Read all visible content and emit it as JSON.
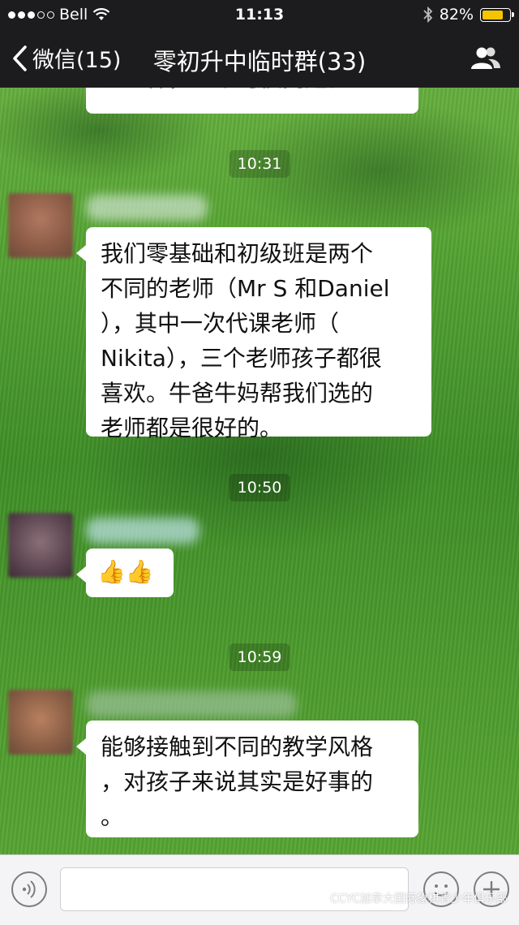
{
  "status_bar": {
    "carrier": "Bell",
    "time": "11:13",
    "battery": "82%",
    "battery_level": 0.82
  },
  "nav": {
    "back_label": "微信(15)",
    "title": "零初升中临时群(33)"
  },
  "messages": [
    {
      "kind": "partial",
      "lines": [
        "上一样，一个习惯问题。"
      ]
    },
    {
      "kind": "time",
      "text": "10:31"
    },
    {
      "kind": "text",
      "lines": [
        "我们零基础和初级班是两个",
        "不同的老师（Mr S 和Daniel",
        "），其中一次代课老师（",
        "Nikita），三个老师孩子都很",
        "喜欢。牛爸牛妈帮我们选的",
        "老师都是很好的。"
      ]
    },
    {
      "kind": "time",
      "text": "10:50"
    },
    {
      "kind": "emoji",
      "text": "👍👍"
    },
    {
      "kind": "time",
      "text": "10:59"
    },
    {
      "kind": "text",
      "lines": [
        "能够接触到不同的教学风格",
        "，对孩子来说其实是好事的",
        "。"
      ]
    }
  ],
  "watermark": "CCYC加拿大国际象棋青少年俱乐部",
  "colors": {
    "bar_dark": "#1c1c1e",
    "bubble": "#ffffff",
    "battery": "#f5c400",
    "grass": "#4f9e2e"
  }
}
